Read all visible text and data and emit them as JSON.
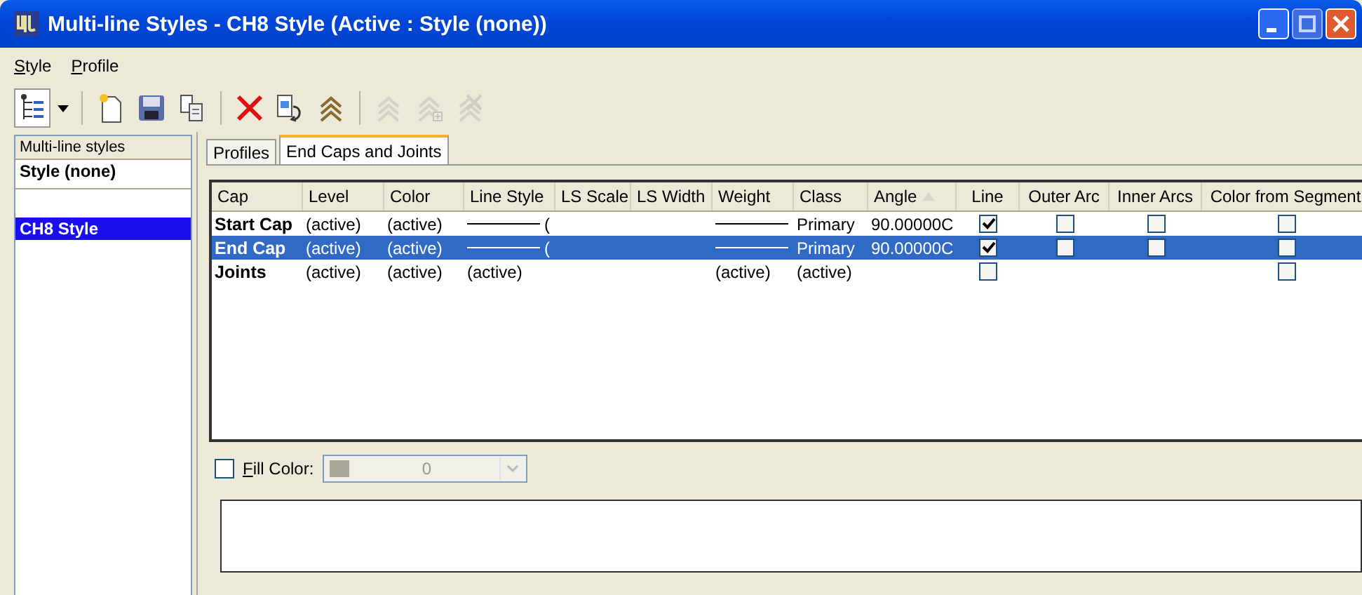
{
  "window": {
    "title": "Multi-line Styles -  CH8 Style (Active : Style (none))"
  },
  "menu": [
    "Style",
    "Profile"
  ],
  "toolbar": [
    {
      "kind": "tree",
      "disabled": false,
      "pressed": true
    },
    {
      "kind": "dropdown",
      "disabled": false,
      "pressed": false
    },
    {
      "kind": "sep"
    },
    {
      "kind": "new",
      "disabled": false,
      "pressed": false
    },
    {
      "kind": "save",
      "disabled": false,
      "pressed": false
    },
    {
      "kind": "copy",
      "disabled": false,
      "pressed": false
    },
    {
      "kind": "sep"
    },
    {
      "kind": "delete",
      "disabled": false,
      "pressed": false
    },
    {
      "kind": "import",
      "disabled": false,
      "pressed": false
    },
    {
      "kind": "stack",
      "disabled": false,
      "pressed": false
    },
    {
      "kind": "sep"
    },
    {
      "kind": "stack",
      "disabled": true,
      "pressed": false
    },
    {
      "kind": "stackadd",
      "disabled": true,
      "pressed": false
    },
    {
      "kind": "stackdel",
      "disabled": true,
      "pressed": false
    }
  ],
  "sidebar": {
    "header": "Multi-line styles",
    "items": [
      {
        "label": "Style (none)",
        "selected": false
      },
      {
        "label": "CH8 Style",
        "selected": true
      }
    ]
  },
  "tabs": [
    {
      "label": "Profiles",
      "selected": false
    },
    {
      "label": "End Caps and Joints",
      "selected": true
    }
  ],
  "table": {
    "columns": [
      {
        "label": "Cap",
        "sorted": false
      },
      {
        "label": "Level",
        "sorted": false
      },
      {
        "label": "Color",
        "sorted": false
      },
      {
        "label": "Line Style",
        "sorted": false
      },
      {
        "label": "LS Scale",
        "sorted": false
      },
      {
        "label": "LS Width",
        "sorted": false
      },
      {
        "label": "Weight",
        "sorted": false
      },
      {
        "label": "Class",
        "sorted": false
      },
      {
        "label": "Angle",
        "sorted": true
      },
      {
        "label": "Line",
        "sorted": false
      },
      {
        "label": "Outer Arc",
        "sorted": false
      },
      {
        "label": "Inner Arcs",
        "sorted": false
      },
      {
        "label": "Color from Segment",
        "sorted": false
      }
    ],
    "rows": [
      {
        "selected": false,
        "cells": [
          {
            "kind": "text",
            "text": "Start Cap"
          },
          {
            "kind": "text",
            "text": "(active)"
          },
          {
            "kind": "text",
            "text": "(active)"
          },
          {
            "kind": "line",
            "text": "("
          },
          {
            "kind": "blank"
          },
          {
            "kind": "blank"
          },
          {
            "kind": "line"
          },
          {
            "kind": "text",
            "text": "Primary"
          },
          {
            "kind": "text",
            "text": "90.00000C"
          },
          {
            "kind": "check",
            "checked": true
          },
          {
            "kind": "check",
            "checked": false
          },
          {
            "kind": "check",
            "checked": false
          },
          {
            "kind": "check",
            "checked": false
          }
        ]
      },
      {
        "selected": true,
        "cells": [
          {
            "kind": "text",
            "text": "End Cap"
          },
          {
            "kind": "text",
            "text": "(active)"
          },
          {
            "kind": "text",
            "text": "(active)"
          },
          {
            "kind": "line",
            "text": "("
          },
          {
            "kind": "blank"
          },
          {
            "kind": "blank"
          },
          {
            "kind": "line"
          },
          {
            "kind": "text",
            "text": "Primary"
          },
          {
            "kind": "text",
            "text": "90.00000C"
          },
          {
            "kind": "check",
            "checked": true
          },
          {
            "kind": "check",
            "checked": false
          },
          {
            "kind": "check",
            "checked": false
          },
          {
            "kind": "check",
            "checked": false
          }
        ]
      },
      {
        "selected": false,
        "cells": [
          {
            "kind": "text",
            "text": "Joints"
          },
          {
            "kind": "text",
            "text": "(active)"
          },
          {
            "kind": "text",
            "text": "(active)"
          },
          {
            "kind": "text",
            "text": "(active)"
          },
          {
            "kind": "blank"
          },
          {
            "kind": "blank"
          },
          {
            "kind": "text",
            "text": "(active)"
          },
          {
            "kind": "text",
            "text": "(active)"
          },
          {
            "kind": "blank"
          },
          {
            "kind": "check",
            "checked": false
          },
          {
            "kind": "blank"
          },
          {
            "kind": "blank"
          },
          {
            "kind": "check",
            "checked": false
          }
        ]
      }
    ]
  },
  "fill": {
    "label": "Fill Color:",
    "checked": false,
    "value": "0",
    "disabled": true
  }
}
